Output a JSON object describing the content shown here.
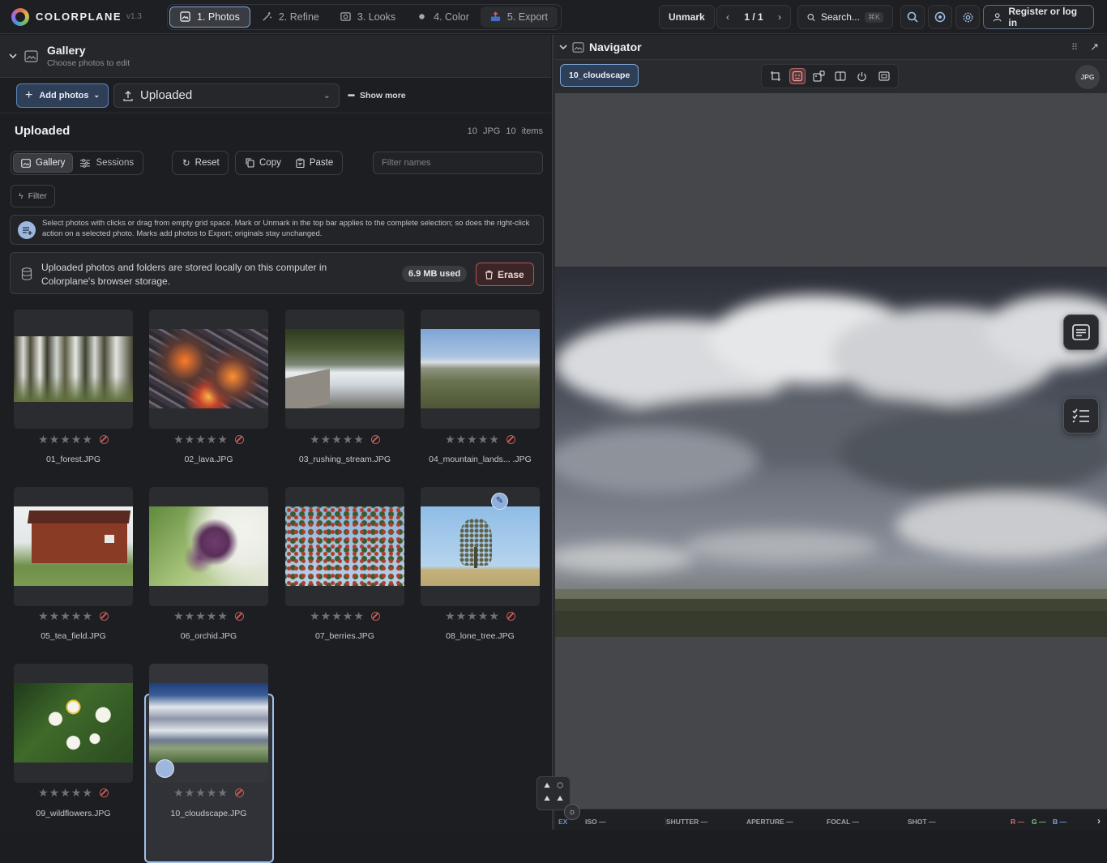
{
  "app": {
    "name": "COLORPLANE",
    "version": "v1.3"
  },
  "steps": [
    {
      "label": "1. Photos",
      "active": true
    },
    {
      "label": "2. Refine"
    },
    {
      "label": "3. Looks"
    },
    {
      "label": "4. Color"
    },
    {
      "label": "5. Export"
    }
  ],
  "topbar": {
    "unmark": "Unmark",
    "pager": "1 / 1",
    "search": "Search...",
    "search_kbd": "⌘K",
    "register": "Register or log in"
  },
  "gallery": {
    "title": "Gallery",
    "subtitle": "Choose photos to edit",
    "add": "Add photos",
    "source": "Uploaded",
    "show_more": "Show more",
    "heading": "Uploaded",
    "counts": "10 JPG 10 items",
    "tab_gallery": "Gallery",
    "tab_sessions": "Sessions",
    "reset": "Reset",
    "copy": "Copy",
    "paste": "Paste",
    "filter_placeholder": "Filter names",
    "filter": "Filter",
    "info": "Select photos with clicks or drag from empty grid space. Mark or Unmark in the top bar applies to the complete selection; so does the right-click action on a selected photo. Marks add photos to Export; originals stay unchanged.",
    "storage": "Uploaded photos and folders are stored locally on this computer in Colorplane's browser storage.",
    "used": "6.9 MB used",
    "erase": "Erase"
  },
  "photos": [
    {
      "name": "01_forest.JPG",
      "rating": 0
    },
    {
      "name": "02_lava.JPG",
      "rating": 0
    },
    {
      "name": "03_rushing_stream.JPG",
      "rating": 0
    },
    {
      "name": "04_mountain_lands... .JPG",
      "rating": 0
    },
    {
      "name": "05_tea_field.JPG",
      "rating": 0
    },
    {
      "name": "06_orchid.JPG",
      "rating": 0
    },
    {
      "name": "07_berries.JPG",
      "rating": 0
    },
    {
      "name": "08_lone_tree.JPG",
      "rating": 0
    },
    {
      "name": "09_wildflowers.JPG",
      "rating": 0
    },
    {
      "name": "10_cloudscape.JPG",
      "rating": 0,
      "selected": true
    }
  ],
  "navigator": {
    "title": "Navigator",
    "chip": "10_cloudscape",
    "format": "JPG"
  },
  "status": {
    "ex": "EX",
    "iso": "ISO —",
    "shutter": "SHUTTER —",
    "aperture": "APERTURE —",
    "focal": "FOCAL —",
    "shot": "SHOT —",
    "r": "R —",
    "g": "G —",
    "b": "B —"
  }
}
